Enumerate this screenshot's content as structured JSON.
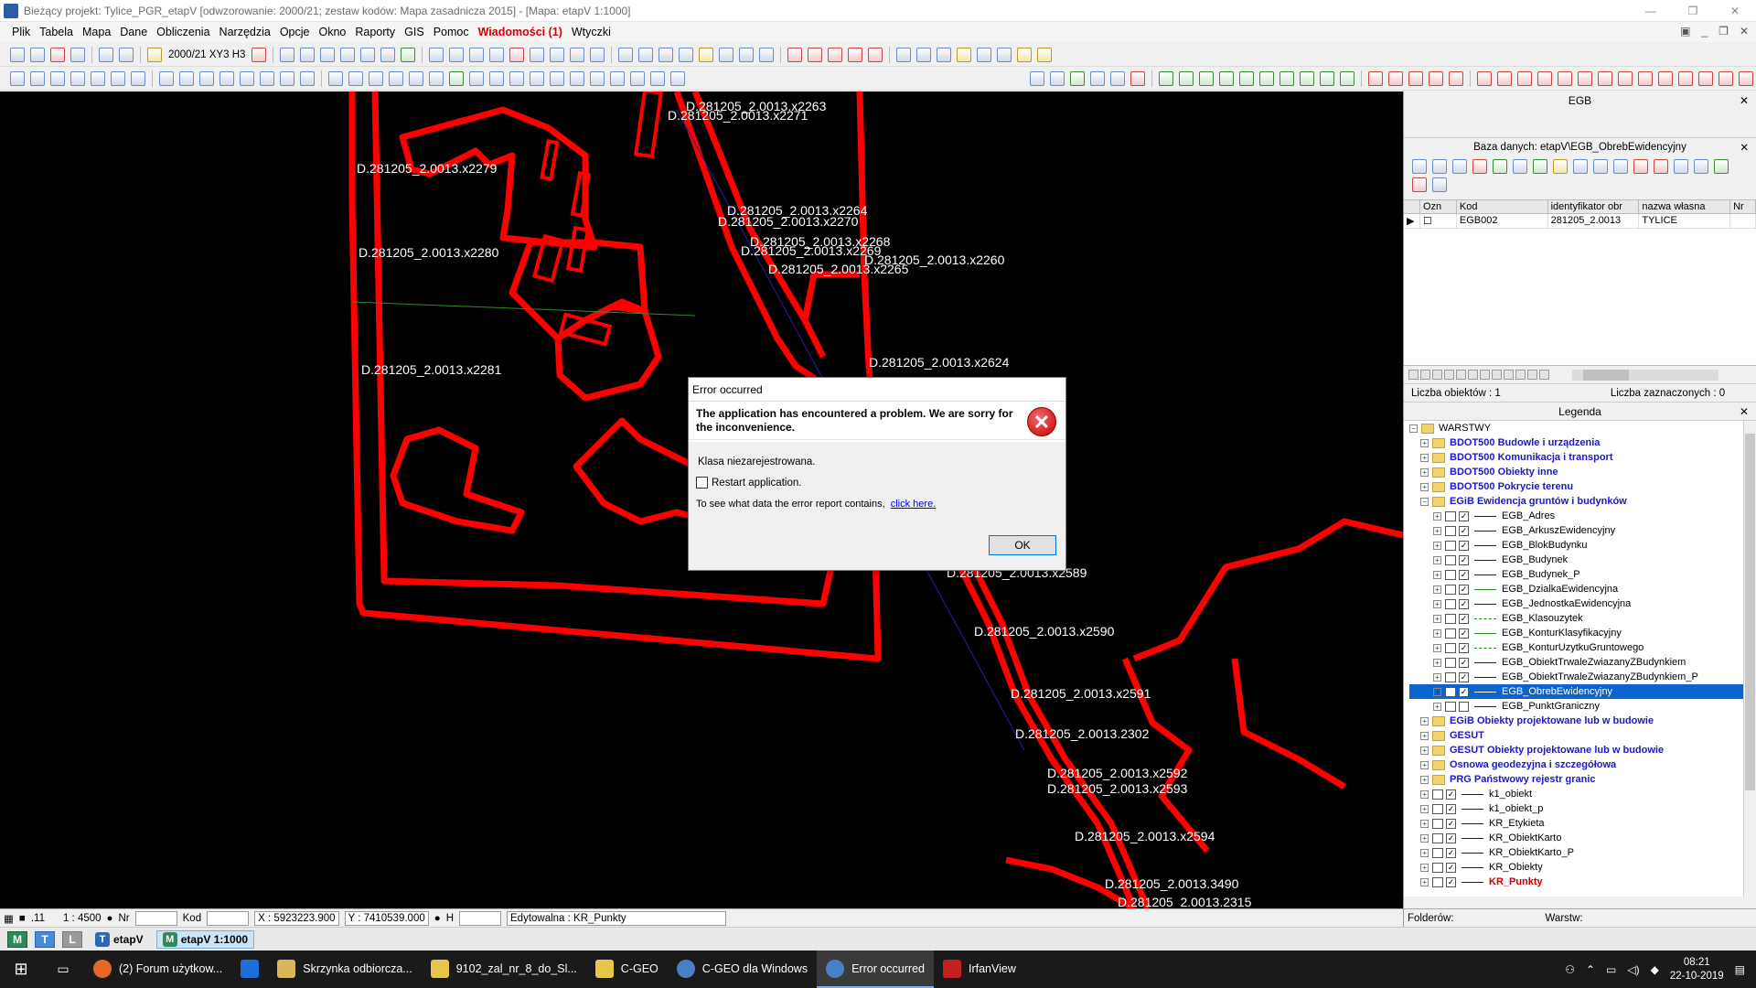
{
  "window": {
    "title": "Bieżący projekt: Tylice_PGR_etapV [odwzorowanie: 2000/21; zestaw kodów: Mapa zasadnicza 2015] - [Mapa: etapV  1:1000]"
  },
  "menu": {
    "items": [
      "Plik",
      "Tabela",
      "Mapa",
      "Dane",
      "Obliczenia",
      "Narzędzia",
      "Opcje",
      "Okno",
      "Raporty",
      "GIS",
      "Pomoc"
    ],
    "alert": "Wiadomości (1)",
    "last": "Wtyczki"
  },
  "toolbar": {
    "coord_system": "2000/21 XY3 H3"
  },
  "map": {
    "labels": [
      "D.281205_2.0013.x2279",
      "D.281205_2.0013.x2280",
      "D.281205_2.0013.x2281",
      "D.281205_2.0013.x2263",
      "D.281205_2.0013.x2271",
      "D.281205_2.0013.x2264",
      "D.281205_2.0013.x2270",
      "D.281205_2.0013.x2268",
      "D.281205_2.0013.x2269",
      "D.281205_2.0013.x2265",
      "D.281205_2.0013.x2260",
      "D.281205_2.0013.x2624",
      "D.281205_2.0013.x2589",
      "D.281205_2.0013.x2590",
      "D.281205_2.0013.x2591",
      "D.281205_2.0013.2302",
      "D.281205_2.0013.x2592",
      "D.281205_2.0013.x2593",
      "D.281205_2.0013.x2594",
      "D.281205_2.0013.3490",
      "D.281205_2.0013.2315"
    ]
  },
  "dialog": {
    "title": "Error occurred",
    "header": "The application has encountered a problem. We are sorry for the inconvenience.",
    "message": "Klasa niezarejestrowana.",
    "restart_label": "Restart application.",
    "see_data_text": "To see what data the error report contains,",
    "link_text": "click here.",
    "ok_label": "OK"
  },
  "egb_panel": {
    "title": "EGB",
    "db_title": "Baza danych: etapV\\EGB_ObrebEwidencyjny",
    "columns": [
      "Ozn",
      "Kod",
      "identyfikator obr",
      "nazwa własna",
      "Nr"
    ],
    "rows": [
      {
        "kod": "EGB002",
        "identyfikator": "281205_2.0013",
        "nazwa": "TYLICE"
      }
    ],
    "count_label": "Liczba obiektów : 1",
    "selected_label": "Liczba zaznaczonych : 0"
  },
  "legend": {
    "title": "Legenda",
    "root": "WARSTWY",
    "groups_top": [
      "BDOT500 Budowle i urządzenia",
      "BDOT500 Komunikacja i transport",
      "BDOT500 Obiekty inne",
      "BDOT500 Pokrycie terenu",
      "EGiB Ewidencja gruntów i budynków"
    ],
    "egb_layers": [
      "EGB_Adres",
      "EGB_ArkuszEwidencyjny",
      "EGB_BlokBudynku",
      "EGB_Budynek",
      "EGB_Budynek_P",
      "EGB_DzialkaEwidencyjna",
      "EGB_JednostkaEwidencyjna",
      "EGB_Klasouzytek",
      "EGB_KonturKlasyfikacyjny",
      "EGB_KonturUzytkuGruntowego",
      "EGB_ObiektTrwaleZwiazanyZBudynkiem",
      "EGB_ObiektTrwaleZwiazanyZBudynkiem_P",
      "EGB_ObrebEwidencyjny",
      "EGB_PunktGraniczny"
    ],
    "groups_mid": [
      "EGiB Obiekty projektowane lub w budowie",
      "GESUT",
      "GESUT Obiekty projektowane lub w budowie",
      "Osnowa geodezyjna i szczegółowa",
      "PRG Państwowy rejestr granic"
    ],
    "other_layers": [
      "k1_obiekt",
      "k1_obiekt_p",
      "KR_Etykieta",
      "KR_ObiektKarto",
      "KR_ObiektKarto_P",
      "KR_Obiekty",
      "KR_Punkty"
    ],
    "folders_label": "Folderów:",
    "layers_label": "Warstw:"
  },
  "status": {
    "scale": "1 : 4500",
    "nr_label": "Nr",
    "kod_label": "Kod",
    "x": "X : 5923223.900",
    "y": "Y : 7410539.000",
    "h_label": "H",
    "editable": "Edytowalna : KR_Punkty",
    "snap_value": ".11"
  },
  "maptabs": {
    "tab1": "etapV",
    "tab2": "etapV 1:1000"
  },
  "taskbar": {
    "tasks": [
      "(2) Forum użytkow...",
      "Skrzynka odbiorcza...",
      "9102_zal_nr_8_do_Sl...",
      "C-GEO",
      "C-GEO dla Windows",
      "Error occurred",
      "IrfanView"
    ],
    "time": "08:21",
    "date": "22-10-2019"
  }
}
